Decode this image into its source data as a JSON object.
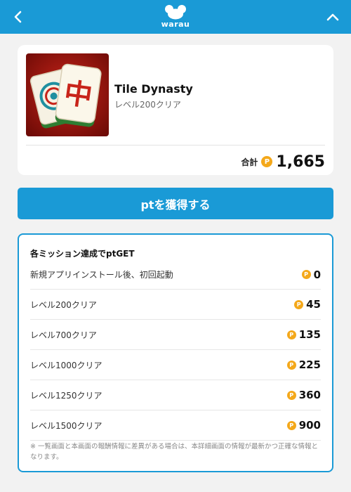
{
  "header": {
    "logo_text": "warau",
    "back_icon": "chevron-left-icon",
    "up_icon": "chevron-up-icon",
    "color": "#1a9ad6"
  },
  "app": {
    "title": "Tile Dynasty",
    "subtitle": "レベル200クリア",
    "icon": "mahjong-tile-icon",
    "tile_glyph": "中",
    "total_label": "合計",
    "total_points": "1,665",
    "point_symbol": "P"
  },
  "cta": {
    "label": "ptを獲得する"
  },
  "missions": {
    "title": "各ミッション達成でptGET",
    "items": [
      {
        "label": "新規アプリインストール後、初回起動",
        "points": "0"
      },
      {
        "label": "レベル200クリア",
        "points": "45"
      },
      {
        "label": "レベル700クリア",
        "points": "135"
      },
      {
        "label": "レベル1000クリア",
        "points": "225"
      },
      {
        "label": "レベル1250クリア",
        "points": "360"
      },
      {
        "label": "レベル1500クリア",
        "points": "900"
      }
    ],
    "note": "※ 一覧画面と本画面の報酬情報に差異がある場合は、本詳細画面の情報が最新かつ正確な情報となります。"
  },
  "colors": {
    "accent": "#1a9ad6",
    "point": "#f4a81a",
    "background": "#f2f2f2"
  }
}
